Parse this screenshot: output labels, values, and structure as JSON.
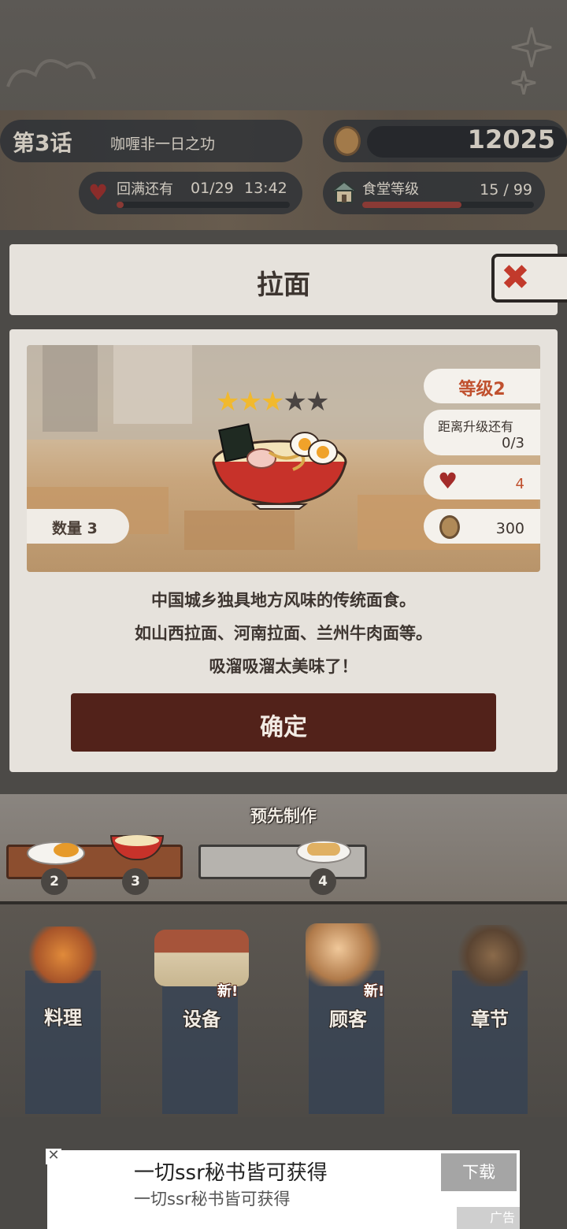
{
  "hud": {
    "chapter_label": "第3话",
    "chapter_subtitle": "咖喱非一日之功",
    "coins": "12025",
    "refill_label": "回满还有",
    "refill_count": "01/29",
    "refill_time": "13:42",
    "refill_progress": 0.04,
    "canteen_level_label": "食堂等级",
    "canteen_level_value": "15 / 99",
    "canteen_level_progress": 0.58
  },
  "dialog": {
    "title": "拉面",
    "close_icon": "close-icon",
    "stars_total": 5,
    "stars_filled": 3,
    "quantity_label": "数量 3",
    "level_label": "等级2",
    "upgrade_label": "距离升级还有",
    "upgrade_value": "0/3",
    "heart_value": "4",
    "coin_value": "300",
    "description": [
      "中国城乡独具地方风味的传统面食。",
      "如山西拉面、河南拉面、兰州牛肉面等。",
      "吸溜吸溜太美味了！"
    ],
    "confirm_label": "确定"
  },
  "prepare": {
    "title": "预先制作",
    "dishes": [
      {
        "count": "2",
        "icon": "curry-rice-icon"
      },
      {
        "count": "3",
        "icon": "ramen-icon"
      },
      {
        "count": "4",
        "icon": "dumplings-icon"
      }
    ]
  },
  "menu": {
    "items": [
      {
        "label": "料理",
        "new": ""
      },
      {
        "label": "设备",
        "new": "新!"
      },
      {
        "label": "顾客",
        "new": "新!"
      },
      {
        "label": "章节",
        "new": ""
      }
    ]
  },
  "ad": {
    "close": "✕",
    "title": "一切ssr秘书皆可获得",
    "subtitle": "一切ssr秘书皆可获得",
    "download_label": "下载",
    "tag": "广告"
  },
  "colors": {
    "accent_red": "#c0502e",
    "confirm_bg": "#52221a",
    "star_gold": "#f1b92e"
  }
}
